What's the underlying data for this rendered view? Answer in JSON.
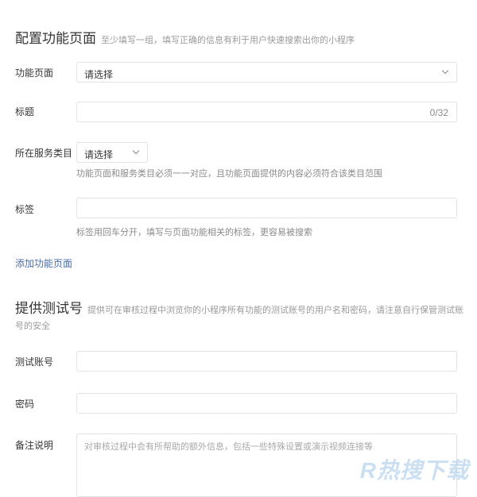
{
  "section1": {
    "title": "配置功能页面",
    "desc": "至少填写一组，填写正确的信息有利于用户快速搜索出你的小程序"
  },
  "function_page": {
    "label": "功能页面",
    "value": "请选择"
  },
  "title_field": {
    "label": "标题",
    "counter": "0/32",
    "value": ""
  },
  "service_category": {
    "label": "所在服务类目",
    "value": "请选择",
    "hint": "功能页面和服务类目必须一一对应，且功能页面提供的内容必须符合该类目范围"
  },
  "tags": {
    "label": "标签",
    "value": "",
    "hint": "标签用回车分开，填写与页面功能相关的标签，更容易被搜索"
  },
  "add_function_page": "添加功能页面",
  "section2": {
    "title": "提供测试号",
    "desc": "提供可在审核过程中浏览你的小程序所有功能的测试账号的用户名和密码，请注意自行保管测试账",
    "desc_cont": "号的安全"
  },
  "test_account": {
    "label": "测试账号",
    "value": ""
  },
  "password": {
    "label": "密码",
    "value": ""
  },
  "remarks": {
    "label": "备注说明",
    "placeholder": "对审核过程中会有所帮助的额外信息，包括一些特殊设置或演示视频连接等"
  },
  "watermark": "R热搜下载",
  "colors": {
    "link": "#4a6ea8",
    "border": "#e3e3e3",
    "hint": "#8a8a8a"
  }
}
